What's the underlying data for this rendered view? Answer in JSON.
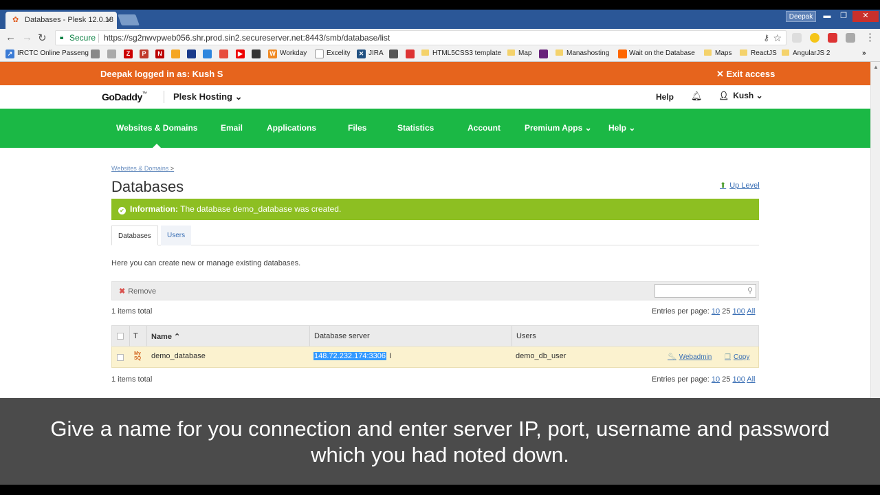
{
  "browser": {
    "tab_title": "Databases - Plesk 12.0.18",
    "tab_close": "×",
    "profile_name": "Deepak",
    "secure_label": "Secure",
    "url": "https://sg2nwvpweb056.shr.prod.sin2.secureserver.net:8443/smb/database/list",
    "bookmarks": [
      {
        "label": "IRCTC Online Passeng"
      },
      {
        "label": "Workday"
      },
      {
        "label": "Excelity"
      },
      {
        "label": "JIRA"
      },
      {
        "label": "HTML5CSS3 template"
      },
      {
        "label": "Map"
      },
      {
        "label": "Manashosting"
      },
      {
        "label": "Wait on the Database"
      },
      {
        "label": "Maps"
      },
      {
        "label": "ReactJS"
      },
      {
        "label": "AngularJS 2"
      }
    ],
    "bookmarks_overflow": "»"
  },
  "impersonation_bar": {
    "message": "Deepak logged in as: Kush S",
    "exit_label": "✕ Exit access"
  },
  "header": {
    "logo_text": "GoDaddy",
    "logo_tm": "™",
    "product": "Plesk Hosting ⌄",
    "help": "Help",
    "user": "Kush ⌄"
  },
  "nav": {
    "items": [
      {
        "label": "Websites & Domains"
      },
      {
        "label": "Email"
      },
      {
        "label": "Applications"
      },
      {
        "label": "Files"
      },
      {
        "label": "Statistics"
      },
      {
        "label": "Account"
      },
      {
        "label": "Premium Apps ⌄"
      },
      {
        "label": "Help ⌄"
      }
    ]
  },
  "page": {
    "breadcrumb": "Websites & Domains",
    "breadcrumb_sep": ">",
    "title": "Databases",
    "up_level": "Up Level",
    "info_label": "Information:",
    "info_message": "The database demo_database was created.",
    "tabs": [
      {
        "label": "Databases",
        "active": true
      },
      {
        "label": "Users",
        "active": false
      }
    ],
    "description": "Here you can create new or manage existing databases.",
    "remove_label": "Remove",
    "search_placeholder": "",
    "items_total": "1 items total",
    "entries_label": "Entries per page:",
    "entries_options": [
      "10",
      "25",
      "100",
      "All"
    ],
    "entries_selected": "All"
  },
  "table": {
    "columns": [
      "T",
      "Name ⌃",
      "Database server",
      "Users"
    ],
    "rows": [
      {
        "type_icon": "MySQL",
        "name": "demo_database",
        "server": "148.72.232.174:3306",
        "users": "demo_db_user",
        "actions": [
          "Webadmin",
          "Copy"
        ]
      }
    ]
  },
  "caption": {
    "text": "Give a name for you connection and enter server IP, port, username and password which you had noted down."
  },
  "colors": {
    "orange_bar": "#e6641d",
    "green_nav": "#1bb845",
    "info_green": "#8dbf22",
    "selected_row": "#fbf2cf",
    "link": "#3a6fb5"
  }
}
